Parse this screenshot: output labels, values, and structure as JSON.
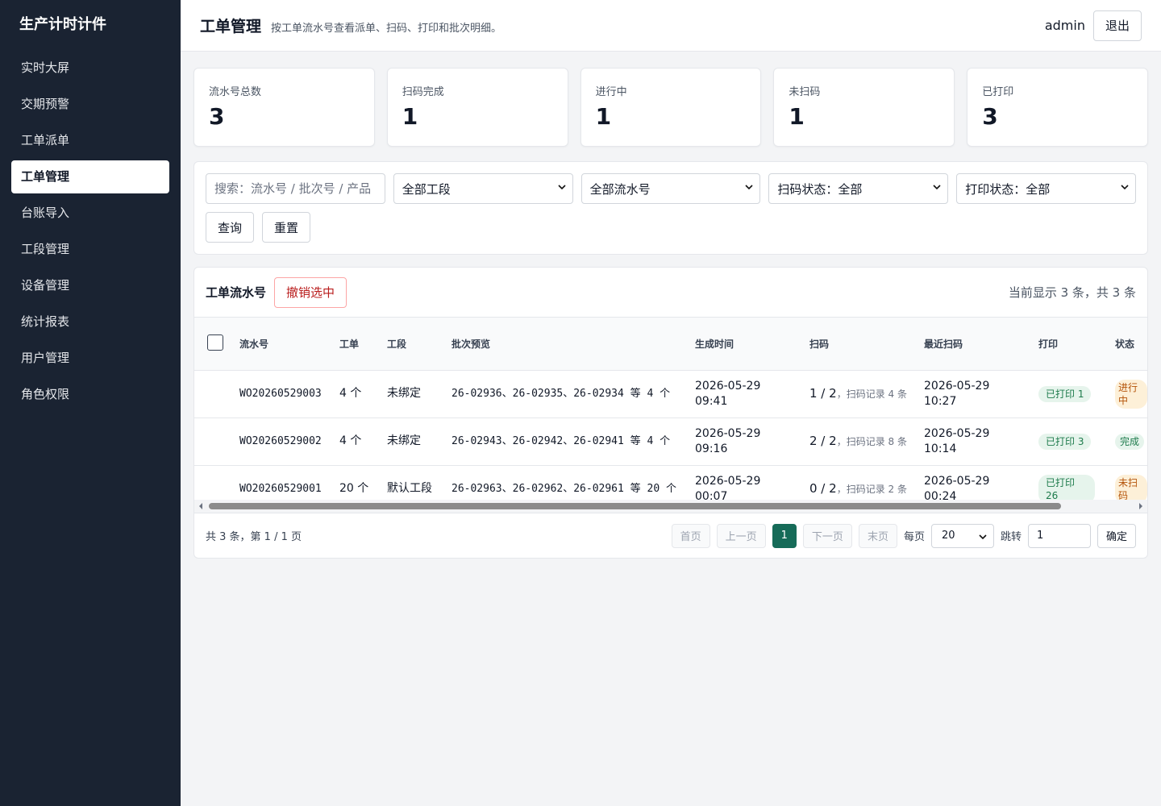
{
  "sidebar": {
    "brand": "生产计时计件",
    "items": [
      {
        "label": "实时大屏"
      },
      {
        "label": "交期预警"
      },
      {
        "label": "工单派单"
      },
      {
        "label": "工单管理"
      },
      {
        "label": "台账导入"
      },
      {
        "label": "工段管理"
      },
      {
        "label": "设备管理"
      },
      {
        "label": "统计报表"
      },
      {
        "label": "用户管理"
      },
      {
        "label": "角色权限"
      }
    ],
    "active_index": 3
  },
  "header": {
    "title": "工单管理",
    "subtitle": "按工单流水号查看派单、扫码、打印和批次明细。",
    "user": "admin",
    "logout_label": "退出"
  },
  "stats": [
    {
      "label": "流水号总数",
      "value": "3"
    },
    {
      "label": "扫码完成",
      "value": "1"
    },
    {
      "label": "进行中",
      "value": "1"
    },
    {
      "label": "未扫码",
      "value": "1"
    },
    {
      "label": "已打印",
      "value": "3"
    }
  ],
  "filters": {
    "search_placeholder": "搜索：流水号 / 批次号 / 产品",
    "stage": "全部工段",
    "serial": "全部流水号",
    "scan_status": "扫码状态：全部",
    "print_status": "打印状态：全部",
    "query_label": "查询",
    "reset_label": "重置"
  },
  "table": {
    "title": "工单流水号",
    "revoke_label": "撤销选中",
    "count_text": "当前显示 3 条，共 3 条",
    "columns": [
      "流水号",
      "工单",
      "工段",
      "批次预览",
      "生成时间",
      "扫码",
      "最近扫码",
      "打印",
      "状态"
    ],
    "rows": [
      {
        "serial": "WO20260529003",
        "orders": "4 个",
        "stage": "未绑定",
        "batches": "26-02936、26-02935、26-02934 等 4 个",
        "created": "2026-05-29 09:41",
        "scan": "1 / 2",
        "scan_records": "，扫码记录 4 条",
        "last_scan": "2026-05-29 10:27",
        "print": "已打印 1",
        "status": "进行中",
        "status_color": "#b45309"
      },
      {
        "serial": "WO20260529002",
        "orders": "4 个",
        "stage": "未绑定",
        "batches": "26-02943、26-02942、26-02941 等 4 个",
        "created": "2026-05-29 09:16",
        "scan": "2 / 2",
        "scan_records": "，扫码记录 8 条",
        "last_scan": "2026-05-29 10:14",
        "print": "已打印 3",
        "status": "完成",
        "status_color": "#1e7b4c"
      },
      {
        "serial": "WO20260529001",
        "orders": "20 个",
        "stage": "默认工段",
        "batches": "26-02963、26-02962、26-02961 等 20 个",
        "created": "2026-05-29 00:07",
        "scan": "0 / 2",
        "scan_records": "，扫码记录 2 条",
        "last_scan": "2026-05-29 00:24",
        "print": "已打印 26",
        "status": "未扫码",
        "status_color": "#b45309"
      }
    ]
  },
  "pager": {
    "info": "共 3 条，第 1 / 1 页",
    "first": "首页",
    "prev": "上一页",
    "current": "1",
    "next": "下一页",
    "last": "末页",
    "per_page_label": "每页",
    "per_page": "20",
    "jump_label": "跳转",
    "jump_value": "1",
    "ok_label": "确定"
  },
  "colors": {
    "sidebar_bg": "#1a2332",
    "accent": "#166b58",
    "danger": "#b91c1c"
  }
}
